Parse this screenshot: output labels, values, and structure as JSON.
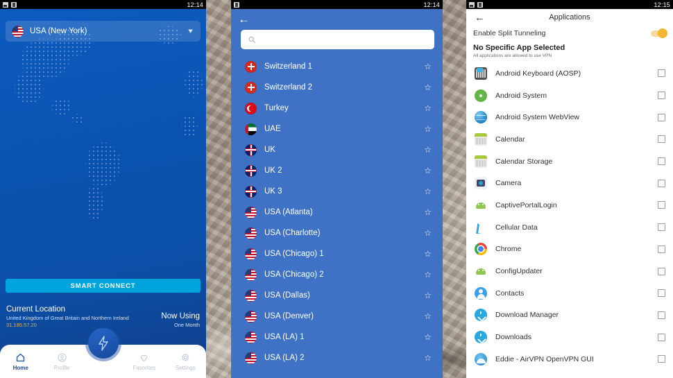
{
  "panel_home": {
    "statusbar": {
      "time": "12:14",
      "icons": [
        "image-icon",
        "document-icon"
      ]
    },
    "location_selector": {
      "flag": "us-flag-icon",
      "label": "USA (New York)",
      "chevron": "chevron-down-icon"
    },
    "smart_connect_label": "SMART CONNECT",
    "current_location": {
      "title": "Current Location",
      "country": "United Kingdom of Great Britain and Northern Ireland",
      "ip": "31.185.57.20"
    },
    "now_using": {
      "title": "Now Using",
      "plan": "One Month"
    },
    "fab_icon": "lightning-bolt-icon",
    "nav": [
      {
        "label": "Home",
        "icon": "home-icon",
        "active": true
      },
      {
        "label": "Profile",
        "icon": "person-circle-icon",
        "active": false
      },
      {
        "label": "Favorites",
        "icon": "heart-icon",
        "active": false
      },
      {
        "label": "Settings",
        "icon": "gear-icon",
        "active": false
      }
    ]
  },
  "panel_servers": {
    "statusbar": {
      "time": "12:14",
      "icons": [
        "document-icon"
      ]
    },
    "back_icon": "back-arrow-icon",
    "search": {
      "value": "",
      "placeholder": "",
      "icon": "search-icon"
    },
    "rows": [
      {
        "name": "Switzerland 1",
        "flag": "ch"
      },
      {
        "name": "Switzerland 2",
        "flag": "ch"
      },
      {
        "name": "Turkey",
        "flag": "tr"
      },
      {
        "name": "UAE",
        "flag": "ae"
      },
      {
        "name": "UK",
        "flag": "uk"
      },
      {
        "name": "UK 2",
        "flag": "uk"
      },
      {
        "name": "UK 3",
        "flag": "uk"
      },
      {
        "name": "USA (Atlanta)",
        "flag": "us"
      },
      {
        "name": "USA (Charlotte)",
        "flag": "us"
      },
      {
        "name": "USA (Chicago) 1",
        "flag": "us"
      },
      {
        "name": "USA (Chicago) 2",
        "flag": "us"
      },
      {
        "name": "USA (Dallas)",
        "flag": "us"
      },
      {
        "name": "USA (Denver)",
        "flag": "us"
      },
      {
        "name": "USA (LA) 1",
        "flag": "us"
      },
      {
        "name": "USA (LA) 2",
        "flag": "us"
      }
    ]
  },
  "panel_applications": {
    "statusbar": {
      "time": "12:15",
      "icons": [
        "image-icon",
        "document-icon"
      ]
    },
    "back_icon": "back-arrow-icon",
    "title": "Applications",
    "split_tunneling": {
      "label": "Enable Split Tunneling",
      "enabled": true,
      "accent": "#f5b731"
    },
    "no_app_selected": {
      "title": "No Specific App Selected",
      "subtitle": "All applications are allowed to use VPN"
    },
    "apps": [
      {
        "name": "Android Keyboard (AOSP)",
        "icon": "keyboard-icon",
        "checked": false
      },
      {
        "name": "Android System",
        "icon": "gear-green-icon",
        "checked": false
      },
      {
        "name": "Android System WebView",
        "icon": "globe-icon",
        "checked": false
      },
      {
        "name": "Calendar",
        "icon": "calendar-icon",
        "checked": false
      },
      {
        "name": "Calendar Storage",
        "icon": "calendar-icon",
        "checked": false
      },
      {
        "name": "Camera",
        "icon": "camera-icon",
        "checked": false
      },
      {
        "name": "CaptivePortalLogin",
        "icon": "android-robot-icon",
        "checked": false
      },
      {
        "name": "Cellular Data",
        "icon": "phone-icon",
        "checked": false
      },
      {
        "name": "Chrome",
        "icon": "chrome-icon",
        "checked": false
      },
      {
        "name": "ConfigUpdater",
        "icon": "android-robot-icon",
        "checked": false
      },
      {
        "name": "Contacts",
        "icon": "contacts-icon",
        "checked": false
      },
      {
        "name": "Download Manager",
        "icon": "download-icon",
        "checked": false
      },
      {
        "name": "Downloads",
        "icon": "download-icon",
        "checked": false
      },
      {
        "name": "Eddie - AirVPN OpenVPN GUI",
        "icon": "eddie-cloud-icon",
        "checked": false
      }
    ]
  }
}
